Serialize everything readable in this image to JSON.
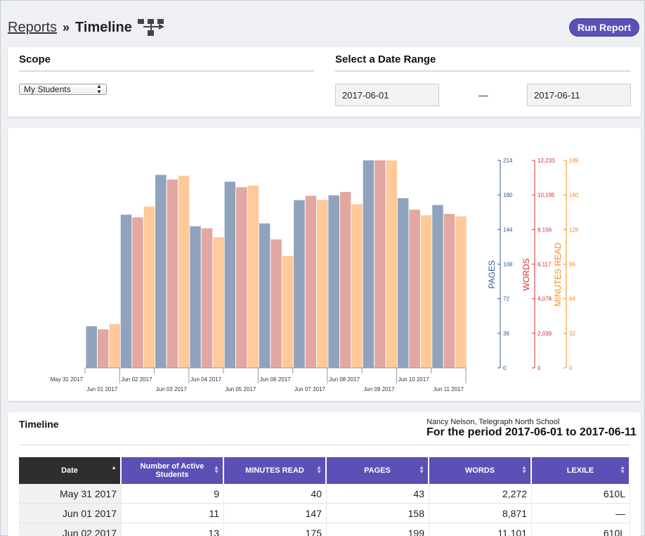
{
  "header": {
    "breadcrumb_link": "Reports",
    "separator": "»",
    "title": "Timeline",
    "title_icon": "sitemap-icon",
    "run_button": "Run Report"
  },
  "scope": {
    "label": "Scope",
    "selected": "My Students",
    "date_label": "Select a Date Range",
    "start_date": "2017-06-01",
    "dash": "—",
    "end_date": "2017-06-11"
  },
  "colors": {
    "accent": "#5b50b5",
    "pages": "#8fa3bd",
    "words": "#e3a7a2",
    "minutes": "#ffc99a",
    "pages_axis": "#2f5b94",
    "words_axis": "#d0312d",
    "minutes_axis": "#f7881f"
  },
  "chart_data": {
    "type": "bar",
    "categories": [
      "May 31 2017",
      "Jun 01 2017",
      "Jun 02 2017",
      "Jun 03 2017",
      "Jun 04 2017",
      "Jun 05 2017",
      "Jun 06 2017",
      "Jun 07 2017",
      "Jun 08 2017",
      "Jun 09 2017",
      "Jun 10 2017",
      "Jun 11 2017"
    ],
    "series": [
      {
        "name": "PAGES",
        "values": [
          43,
          158,
          199,
          146,
          192,
          149,
          173,
          178,
          214,
          175,
          168
        ]
      },
      {
        "name": "WORDS",
        "values": [
          2272,
          8871,
          11101,
          8229,
          10653,
          7574,
          10146,
          10368,
          12233,
          9327,
          9077
        ]
      },
      {
        "name": "MINUTES READ",
        "values": [
          40,
          147,
          175,
          119,
          166,
          102,
          153,
          149,
          189,
          139,
          138
        ]
      }
    ],
    "axes": [
      {
        "label": "PAGES",
        "ticks": [
          "0",
          "36",
          "72",
          "108",
          "144",
          "180",
          "214"
        ],
        "max": 214
      },
      {
        "label": "WORDS",
        "ticks": [
          "0",
          "2,039",
          "4,078",
          "6,117",
          "8,156",
          "10,195",
          "12,233"
        ],
        "max": 12233
      },
      {
        "label": "MINUTES READ",
        "ticks": [
          "0",
          "32",
          "64",
          "96",
          "128",
          "160",
          "189"
        ],
        "max": 189
      }
    ],
    "grid": false
  },
  "table": {
    "title": "Timeline",
    "who": "Nancy Nelson, Telegraph North School",
    "period": "For the period 2017-06-01 to 2017-06-11",
    "columns": [
      "Date",
      "Number of Active Students",
      "MINUTES READ",
      "PAGES",
      "WORDS",
      "LEXILE"
    ],
    "rows": [
      [
        "May 31 2017",
        "9",
        "40",
        "43",
        "2,272",
        "610L"
      ],
      [
        "Jun 01 2017",
        "11",
        "147",
        "158",
        "8,871",
        "—"
      ],
      [
        "Jun 02 2017",
        "13",
        "175",
        "199",
        "11,101",
        "610L"
      ]
    ]
  }
}
